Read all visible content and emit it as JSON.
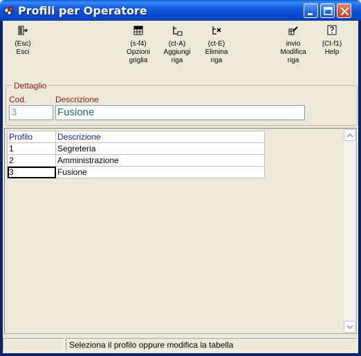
{
  "window": {
    "title": "Profili per Operatore"
  },
  "toolbar": {
    "items": [
      {
        "name": "esci",
        "label": "(Esc)\nEsci"
      },
      {
        "name": "opzioni-griglia",
        "label": "(s-f4)\nOpzioni\ngriglia"
      },
      {
        "name": "aggiungi-riga",
        "label": "(ct-A)\nAggiungi\nriga"
      },
      {
        "name": "elimina-riga",
        "label": "(ct-E)\nElimina\nriga"
      },
      {
        "name": "modifica-riga",
        "label": "invio\nModifica\nriga"
      },
      {
        "name": "help",
        "label": "(Ct-f1)\nHelp"
      }
    ]
  },
  "detail": {
    "group_title": "Dettaglio",
    "cod_label": "Cod.",
    "cod_value": "3",
    "descr_label": "Descrizione",
    "descr_value": "Fusione"
  },
  "grid": {
    "headers": [
      "Profilo",
      "Descrizione"
    ],
    "rows": [
      [
        "1",
        "Segreteria"
      ],
      [
        "2",
        "Amministrazione"
      ],
      [
        "3",
        "Fusione"
      ]
    ]
  },
  "status": {
    "text": "Seleziona il profilo oppure modifica la tabella"
  },
  "colors": {
    "title_bar": "#0a50d6",
    "label_text": "#8b1a0f",
    "header_text": "#0c2590",
    "field_text": "#1a6e8a"
  }
}
